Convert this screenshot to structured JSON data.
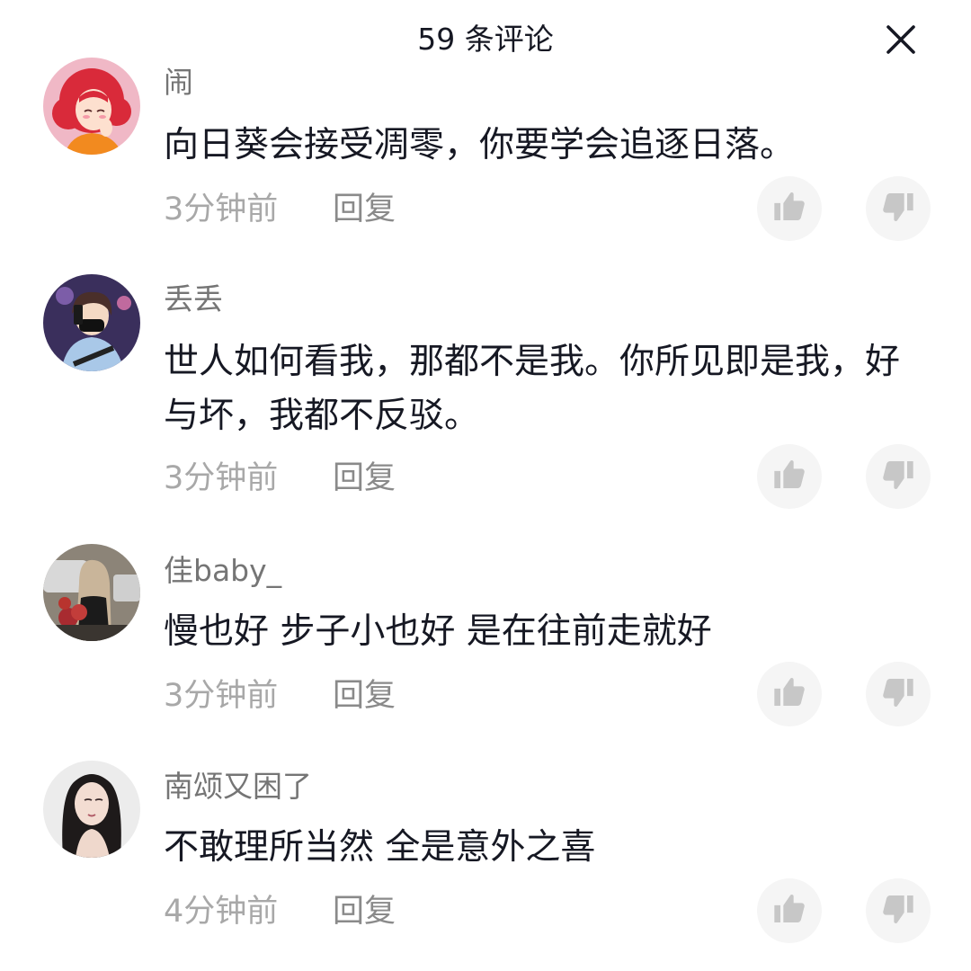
{
  "header": {
    "title": "59 条评论",
    "close_icon": "close-icon"
  },
  "comments": [
    {
      "username": "闹",
      "text": "向日葵会接受凋零，你要学会追逐日落。",
      "time": "3分钟前",
      "reply_label": "回复",
      "avatar_icon": "anime-girl-red-hair-avatar"
    },
    {
      "username": "丢丢",
      "text": "世人如何看我，那都不是我。你所见即是我，好与坏，我都不反驳。",
      "time": "3分钟前",
      "reply_label": "回复",
      "avatar_icon": "anime-boy-mask-avatar"
    },
    {
      "username": "佳baby_",
      "text": "慢也好 步子小也好 是在往前走就好",
      "time": "3分钟前",
      "reply_label": "回复",
      "avatar_icon": "girl-with-flowers-photo-avatar"
    },
    {
      "username": "南颂又困了",
      "text": "不敢理所当然 全是意外之喜",
      "time": "4分钟前",
      "reply_label": "回复",
      "avatar_icon": "woman-portrait-photo-avatar"
    }
  ],
  "icons": {
    "like": "thumbs-up-icon",
    "dislike": "thumbs-down-icon"
  },
  "colors": {
    "text_primary": "#161823",
    "text_secondary": "#757575",
    "text_meta": "#a8a8a8",
    "button_bg": "#f5f5f5",
    "icon_gray": "#c7c7c7"
  }
}
